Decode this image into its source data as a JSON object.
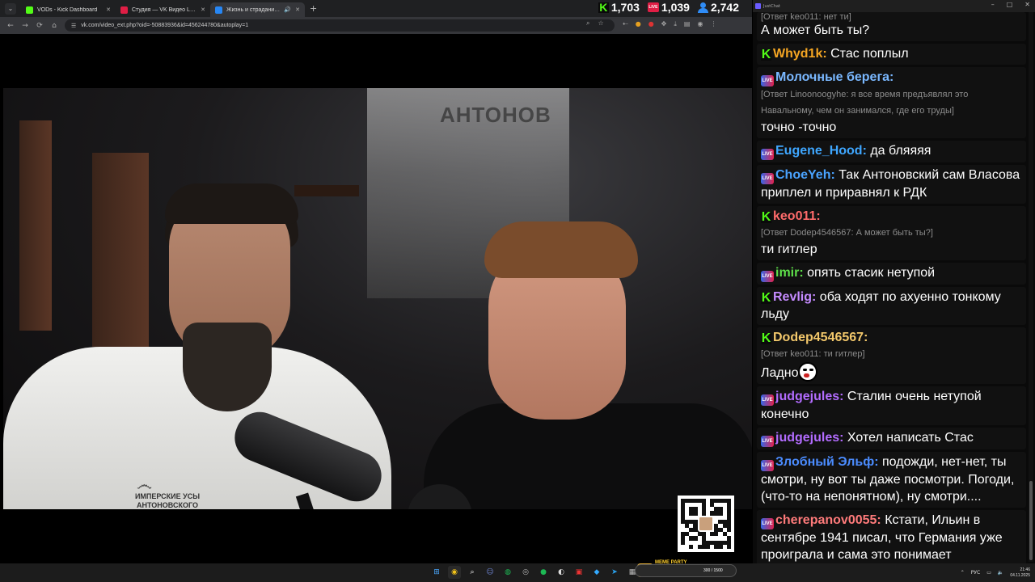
{
  "browser": {
    "tabs": [
      {
        "title": "VODs - Kick Dashboard",
        "favicon_color": "#53fc18",
        "active": false
      },
      {
        "title": "Студия — VK Видео Live",
        "favicon_color": "#e01e45",
        "active": false
      },
      {
        "title": "Жизнь и страдания Романа",
        "favicon_color": "#2787f5",
        "active": true
      }
    ],
    "url": "vk.com/video_ext.php?oid=-50883936&id=456244780&autoplay=1"
  },
  "counters": {
    "kick": "1,703",
    "vk": "1,039",
    "viewers": "2,742",
    "vk_badge": "LIVE"
  },
  "video": {
    "poster_text": "АНТОНОВ",
    "shirt_text": "ИМПЕРСКИЕ УСЫ АНТОНОВСКОГО"
  },
  "chat": {
    "window_title": "JustChat",
    "top_reply": "[Ответ keo011: нет ти]",
    "top_text": "А может быть ты?",
    "messages": [
      {
        "platform": "kick",
        "name": "Whyd1k:",
        "color": "#f5a623",
        "reply": "",
        "text": "Стас поплыл"
      },
      {
        "platform": "vk",
        "name": "Молочные берега:",
        "color": "#7ab8ff",
        "reply": "[Ответ Linoonoogyhe: я все время предъявлял это Навальному, чем он занимался, где его труды]",
        "text": "точно -точно"
      },
      {
        "platform": "vk",
        "name": "Eugene_Hood:",
        "color": "#3fa7ff",
        "reply": "",
        "text": "да бляяяя"
      },
      {
        "platform": "vk",
        "name": "ChoeYeh:",
        "color": "#4aa3ff",
        "reply": "",
        "text": "Так Антоновский сам Власова приплел и приравнял к РДК"
      },
      {
        "platform": "kick",
        "name": "keo011:",
        "color": "#ff6b6b",
        "reply": "[Ответ Dodep4546567: А может быть ты?]",
        "text": "ти гитлер"
      },
      {
        "platform": "vk",
        "name": "imir:",
        "color": "#5ee04a",
        "reply": "",
        "text": "опять стасик нетупой"
      },
      {
        "platform": "kick",
        "name": "Revlig:",
        "color": "#c58bff",
        "reply": "",
        "text": "оба ходят по ахуенно тонкому льду"
      },
      {
        "platform": "kick",
        "name": "Dodep4546567:",
        "color": "#f3c86b",
        "reply": "[Ответ keo011: ти гитлер]",
        "text": "Ладно",
        "emote": true
      },
      {
        "platform": "vk",
        "name": "judgejules:",
        "color": "#b36cff",
        "reply": "",
        "text": "Сталин очень нетупой конечно"
      },
      {
        "platform": "vk",
        "name": "judgejules:",
        "color": "#b36cff",
        "reply": "",
        "text": "Хотел написать Стас"
      },
      {
        "platform": "vk",
        "name": "Злобный Эльф:",
        "color": "#4b8cff",
        "reply": "",
        "text": "подожди, нет-нет, ты смотри, ну вот ты даже посмотри. Погоди, (что-то на непонятном), ну смотри...."
      },
      {
        "platform": "vk",
        "name": "cherepanov0055:",
        "color": "#ff7b7b",
        "reply": "",
        "text": "Кстати, Ильин в сентябре 1941 писал, что Германия уже проиграла и сама это понимает"
      }
    ]
  },
  "taskbar": {
    "meme_party_label": "MEME PARTY",
    "meme_party_progress": "300 / 1500",
    "lang": "РУС",
    "time": "21:46",
    "date": "04.11.2025"
  }
}
